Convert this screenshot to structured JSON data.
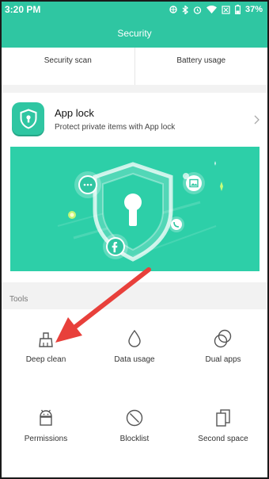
{
  "status_bar": {
    "time": "3:20 PM",
    "battery": "37%",
    "icons": [
      "bluetooth-icon",
      "alarm-icon",
      "wifi-icon",
      "no-sim-icon",
      "battery-icon"
    ]
  },
  "header": {
    "title": "Security"
  },
  "top_tiles": [
    {
      "label": "Security scan"
    },
    {
      "label": "Battery usage"
    }
  ],
  "app_lock": {
    "title": "App lock",
    "subtitle": "Protect private items with App lock"
  },
  "tools": {
    "label": "Tools",
    "items": [
      {
        "label": "Deep clean",
        "icon": "broom-icon"
      },
      {
        "label": "Data usage",
        "icon": "drop-icon"
      },
      {
        "label": "Dual apps",
        "icon": "dual-circles-icon"
      },
      {
        "label": "Permissions",
        "icon": "android-icon"
      },
      {
        "label": "Blocklist",
        "icon": "block-icon"
      },
      {
        "label": "Second space",
        "icon": "second-space-icon"
      }
    ]
  },
  "colors": {
    "accent": "#2fc6a2",
    "banner": "#2dcfa8",
    "arrow": "#e8403b"
  }
}
